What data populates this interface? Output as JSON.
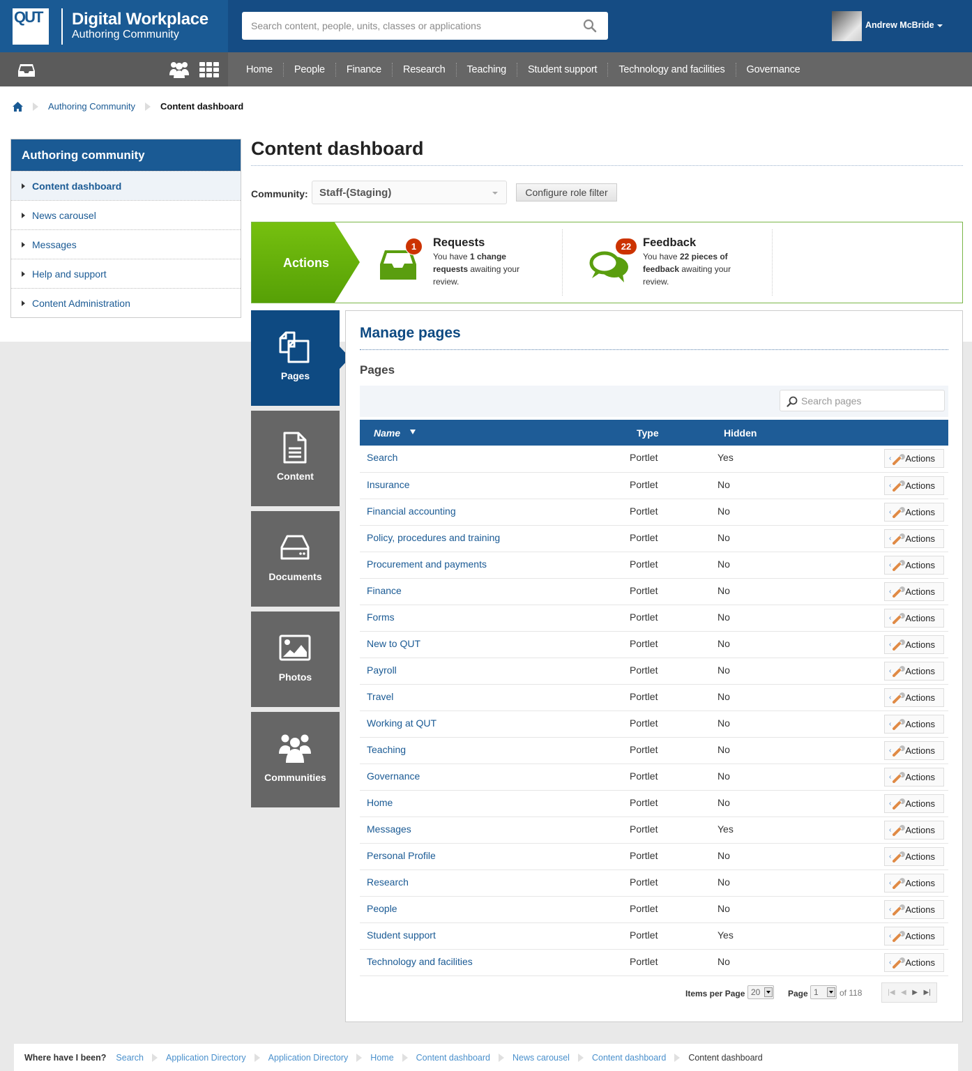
{
  "header": {
    "logo_text": "QUT",
    "brand_title": "Digital Workplace",
    "brand_subtitle": "Authoring Community",
    "search_placeholder": "Search content, people, units, classes or applications",
    "user_name": "Andrew McBride"
  },
  "nav": {
    "items": [
      "Home",
      "People",
      "Finance",
      "Research",
      "Teaching",
      "Student support",
      "Technology and facilities",
      "Governance"
    ]
  },
  "breadcrumb": {
    "items": [
      "Authoring Community"
    ],
    "current": "Content dashboard"
  },
  "sidebar": {
    "title": "Authoring community",
    "items": [
      {
        "label": "Content dashboard",
        "active": true
      },
      {
        "label": "News carousel"
      },
      {
        "label": "Messages"
      },
      {
        "label": "Help and support"
      },
      {
        "label": "Content Administration"
      }
    ]
  },
  "main": {
    "title": "Content dashboard",
    "community_label": "Community:",
    "community_value": "Staff-(Staging)",
    "configure_button": "Configure role filter"
  },
  "actions": {
    "label": "Actions",
    "requests": {
      "title": "Requests",
      "count": "1",
      "text_pre": "You have ",
      "text_bold": "1 change requests",
      "text_post": " awaiting your review."
    },
    "feedback": {
      "title": "Feedback",
      "count": "22",
      "text_pre": "You have ",
      "text_bold": "22 pieces of feedback",
      "text_post": " awaiting your review."
    }
  },
  "tiles": [
    {
      "label": "Pages",
      "active": true
    },
    {
      "label": "Content"
    },
    {
      "label": "Documents"
    },
    {
      "label": "Photos"
    },
    {
      "label": "Communities"
    }
  ],
  "manage": {
    "title": "Manage pages",
    "subtitle": "Pages",
    "search_placeholder": "Search pages",
    "columns": {
      "name": "Name",
      "type": "Type",
      "hidden": "Hidden"
    },
    "action_label": "Actions",
    "rows": [
      {
        "name": "Search",
        "type": "Portlet",
        "hidden": "Yes"
      },
      {
        "name": "Insurance",
        "type": "Portlet",
        "hidden": "No"
      },
      {
        "name": "Financial accounting",
        "type": "Portlet",
        "hidden": "No"
      },
      {
        "name": "Policy, procedures and training",
        "type": "Portlet",
        "hidden": "No"
      },
      {
        "name": "Procurement and payments",
        "type": "Portlet",
        "hidden": "No"
      },
      {
        "name": "Finance",
        "type": "Portlet",
        "hidden": "No"
      },
      {
        "name": "Forms",
        "type": "Portlet",
        "hidden": "No"
      },
      {
        "name": "New to QUT",
        "type": "Portlet",
        "hidden": "No"
      },
      {
        "name": "Payroll",
        "type": "Portlet",
        "hidden": "No"
      },
      {
        "name": "Travel",
        "type": "Portlet",
        "hidden": "No"
      },
      {
        "name": "Working at QUT",
        "type": "Portlet",
        "hidden": "No"
      },
      {
        "name": "Teaching",
        "type": "Portlet",
        "hidden": "No"
      },
      {
        "name": "Governance",
        "type": "Portlet",
        "hidden": "No"
      },
      {
        "name": "Home",
        "type": "Portlet",
        "hidden": "No"
      },
      {
        "name": "Messages",
        "type": "Portlet",
        "hidden": "Yes"
      },
      {
        "name": "Personal Profile",
        "type": "Portlet",
        "hidden": "No"
      },
      {
        "name": "Research",
        "type": "Portlet",
        "hidden": "No"
      },
      {
        "name": "People",
        "type": "Portlet",
        "hidden": "No"
      },
      {
        "name": "Student support",
        "type": "Portlet",
        "hidden": "Yes"
      },
      {
        "name": "Technology and facilities",
        "type": "Portlet",
        "hidden": "No"
      }
    ],
    "pager": {
      "items_per_page_label": "Items per Page",
      "items_per_page": "20",
      "page_label": "Page",
      "page": "1",
      "of_label": "of 118"
    }
  },
  "history": {
    "label": "Where have I been?",
    "items": [
      "Search",
      "Application Directory",
      "Application Directory",
      "Home",
      "Content dashboard",
      "News carousel",
      "Content dashboard"
    ],
    "current": "Content dashboard"
  },
  "colors": {
    "brand_blue": "#1a5a94",
    "header_blue": "#154c84",
    "nav_gray": "#666666",
    "action_green": "#5aa80a",
    "badge_red": "#cc3300",
    "table_header": "#1e5c97"
  }
}
